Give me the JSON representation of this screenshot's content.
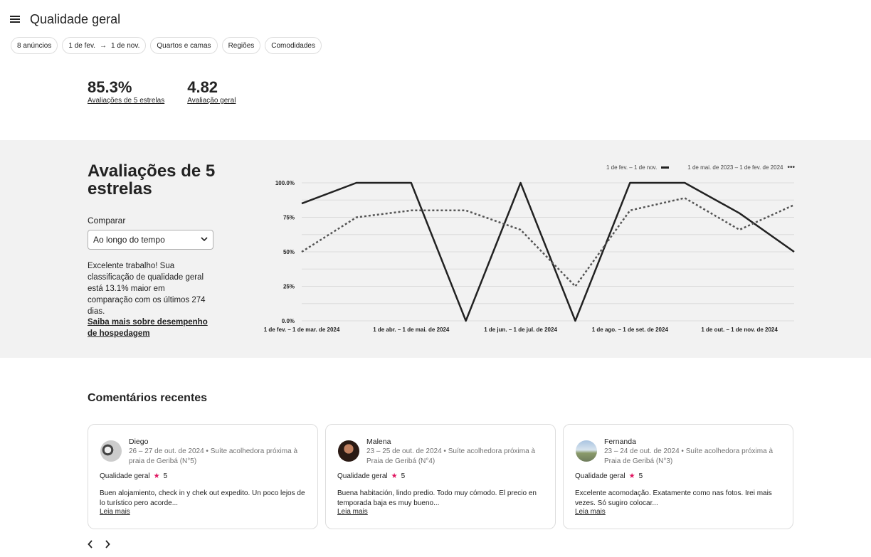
{
  "header": {
    "title": "Qualidade geral",
    "menu_icon": "hamburger-menu-icon"
  },
  "filters": {
    "listings": "8 anúncios",
    "date_from": "1 de fev.",
    "date_to": "1 de nov.",
    "rooms": "Quartos e camas",
    "regions": "Regiões",
    "amenities": "Comodidades"
  },
  "stats": [
    {
      "value": "85.3%",
      "label": "Avaliações de 5 estrelas"
    },
    {
      "value": "4.82",
      "label": "Avaliação geral"
    }
  ],
  "section": {
    "heading": "Avaliações de 5 estrelas",
    "compare_label": "Comparar",
    "compare_value": "Ao longo do tempo",
    "description": "Excelente trabalho! Sua classificação de qualidade geral está 13.1% maior em comparação com os últimos 274 dias.",
    "learn_more": "Saiba mais sobre desempenho de hospedagem"
  },
  "chart_data": {
    "type": "line",
    "title": "",
    "xlabel": "",
    "ylabel": "",
    "ylim": [
      0,
      100
    ],
    "y_ticks": [
      "100.0%",
      "75%",
      "50%",
      "25%",
      "0.0%"
    ],
    "x_tick_labels": [
      "1 de fev. – 1 de mar. de 2024",
      "1 de abr. – 1 de mai. de 2024",
      "1 de jun. – 1 de jul. de 2024",
      "1 de ago. – 1 de set. de 2024",
      "1 de out. – 1 de nov. de 2024"
    ],
    "legend_position": "top-right",
    "grid": true,
    "series": [
      {
        "name": "1 de fev. – 1 de nov.",
        "style": "solid",
        "color": "#222222",
        "values": [
          85,
          100,
          100,
          0,
          100,
          0,
          100,
          100,
          78,
          50
        ]
      },
      {
        "name": "1 de mai. de 2023 – 1 de fev. de 2024",
        "style": "dotted",
        "color": "#555555",
        "values": [
          50,
          75,
          80,
          80,
          66,
          25,
          80,
          89,
          66,
          84
        ]
      }
    ]
  },
  "recent": {
    "title": "Comentários recentes",
    "reviews": [
      {
        "name": "Diego",
        "meta": "26 – 27 de out. de 2024 • Suíte acolhedora próxima à praia de Geribá (N°5)",
        "rating_label": "Qualidade geral",
        "rating": "5",
        "text": "Buen alojamiento, check in y chek out expedito. Un poco lejos de lo turístico pero acorde...",
        "read_more": "Leia mais"
      },
      {
        "name": "Malena",
        "meta": "23 – 25 de out. de 2024 • Suíte acolhedora próxima à Praia de Geribá (N°4)",
        "rating_label": "Qualidade geral",
        "rating": "5",
        "text": "Buena habitación, lindo predio. Todo muy cómodo. El precio en temporada baja es muy bueno...",
        "read_more": "Leia mais"
      },
      {
        "name": "Fernanda",
        "meta": "23 – 24 de out. de 2024 • Suíte acolhedora próxima à Praia de Geribá (N°3)",
        "rating_label": "Qualidade geral",
        "rating": "5",
        "text": "Excelente acomodação. Exatamente como nas fotos. Irei mais vezes. Só sugiro colocar...",
        "read_more": "Leia mais"
      }
    ]
  },
  "colors": {
    "accent_star": "#e01560",
    "section_bg": "#f2f2f2",
    "text": "#222222"
  }
}
